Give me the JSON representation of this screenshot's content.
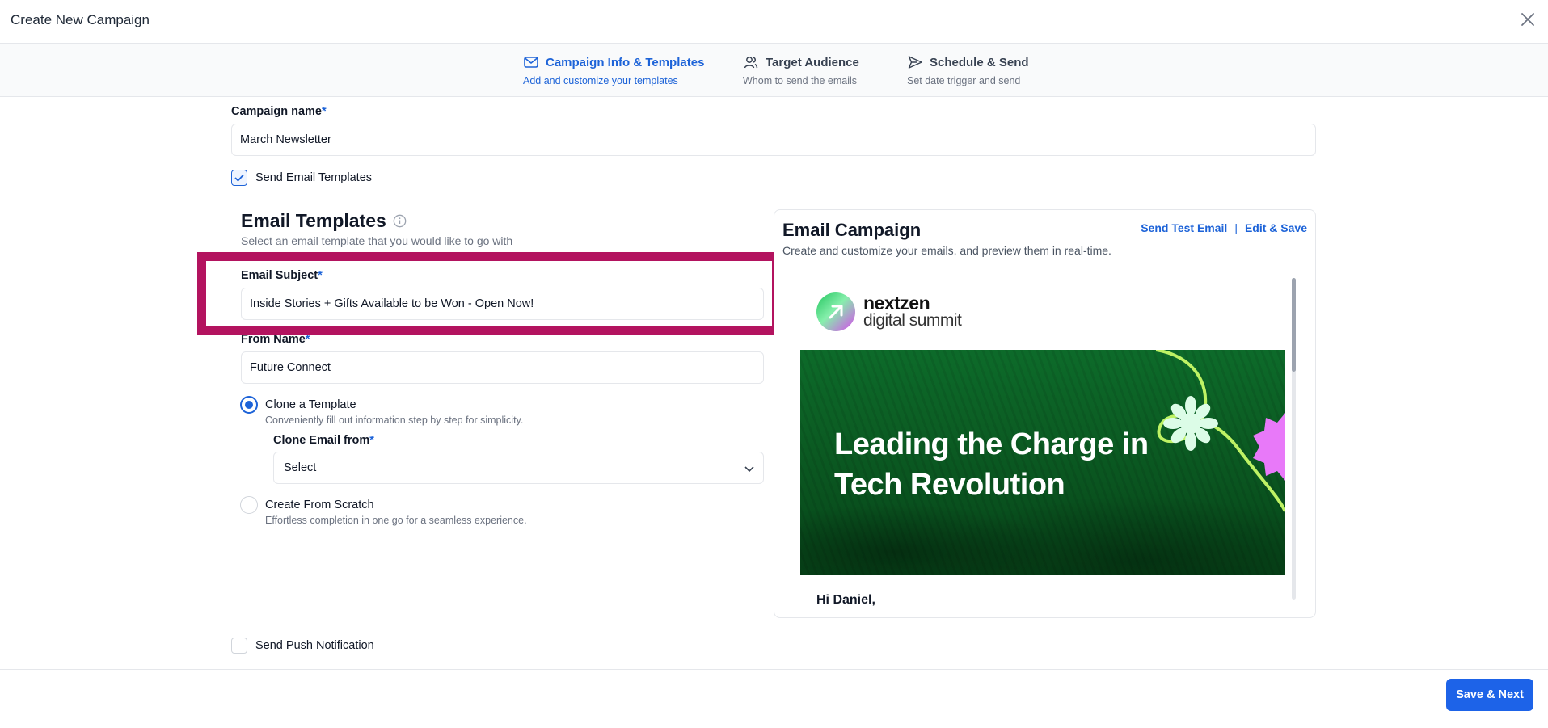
{
  "header": {
    "title": "Create New Campaign",
    "close_icon": "close-icon"
  },
  "steps": [
    {
      "label": "Campaign Info & Templates",
      "sub": "Add and customize your templates",
      "icon": "mail-icon",
      "active": true
    },
    {
      "label": "Target Audience",
      "sub": "Whom to send the emails",
      "icon": "users-icon",
      "active": false
    },
    {
      "label": "Schedule & Send",
      "sub": "Set date trigger and send",
      "icon": "send-icon",
      "active": false
    }
  ],
  "form": {
    "campaign_name_label": "Campaign name",
    "required_mark": "*",
    "campaign_name_value": "March Newsletter",
    "send_email_templates": {
      "label": "Send Email Templates",
      "checked": true
    },
    "templates_title": "Email Templates",
    "templates_sub": "Select an email template that you would like to go with",
    "email_subject_label": "Email Subject",
    "email_subject_value": "Inside Stories + Gifts Available to be Won - Open Now!",
    "from_name_label": "From Name",
    "from_name_value": "Future Connect",
    "clone_option": {
      "title": "Clone a Template",
      "sub": "Conveniently fill out information step by step for simplicity.",
      "selected": true
    },
    "clone_from_label": "Clone Email from",
    "clone_from_value": "Select",
    "scratch_option": {
      "title": "Create From Scratch",
      "sub": "Effortless completion in one go for a seamless experience.",
      "selected": false
    },
    "send_push": {
      "label": "Send Push Notification",
      "checked": false
    }
  },
  "preview": {
    "title": "Email Campaign",
    "sub": "Create and customize your emails, and preview them in real-time.",
    "send_test_label": "Send Test Email",
    "separator": "|",
    "edit_save_label": "Edit & Save",
    "logo_name": "nextzen",
    "logo_tag": "digital summit",
    "hero_line1": "Leading the Charge in",
    "hero_line2": "Tech Revolution",
    "greeting": "Hi Daniel,"
  },
  "footer": {
    "save_next_label": "Save & Next"
  },
  "colors": {
    "accent": "#1d63d8",
    "highlight": "#b3135f",
    "hero_green": "#0b5a22",
    "lime": "#bef264",
    "pink": "#e879f9"
  }
}
